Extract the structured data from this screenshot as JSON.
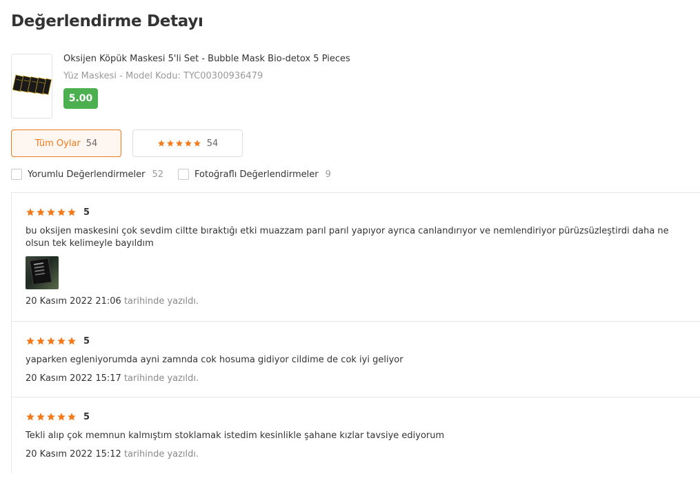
{
  "page": {
    "title": "Değerlendirme Detayı"
  },
  "product": {
    "name": "Oksijen Köpük Maskesi 5'li Set - Bubble Mask Bio-detox 5 Pieces",
    "meta": "Yüz Maskesi - Model Kodu: TYC00300936479",
    "rating": "5.00",
    "thumb_icon": "face-mask-pack-icon"
  },
  "filters": {
    "all": {
      "label": "Tüm Oylar",
      "count": "54"
    },
    "five_star": {
      "stars": 5,
      "count": "54"
    }
  },
  "checks": {
    "comments": {
      "label": "Yorumlu Değerlendirmeler",
      "count": "52"
    },
    "photos": {
      "label": "Fotoğraflı Değerlendirmeler",
      "count": "9"
    }
  },
  "reviews": [
    {
      "stars": 5,
      "rating_label": "5",
      "text": "bu oksijen maskesini çok sevdim ciltte bıraktığı etki muazzam parıl parıl yapıyor ayrıca canlandırıyor ve nemlendiriyor pürüzsüzleştirdi daha ne olsun tek kelimeyle bayıldım",
      "date": "20 Kasım 2022 21:06",
      "suffix": "tarihinde yazıldı."
    },
    {
      "stars": 5,
      "rating_label": "5",
      "text": "yaparken egleniyorumda ayni zamnda cok hosuma gidiyor cildime de cok iyi geliyor",
      "date": "20 Kasım 2022 15:17",
      "suffix": "tarihinde yazıldı."
    },
    {
      "stars": 5,
      "rating_label": "5",
      "text": "Tekli alıp çok memnun kalmıştım stoklamak istedim kesinlikle şahane kızlar tavsiye ediyorum",
      "date": "20 Kasım 2022 15:12",
      "suffix": "tarihinde yazıldı."
    }
  ],
  "colors": {
    "accent": "#f27a1a",
    "star": "#f27a1a",
    "badge": "#4caf50"
  }
}
